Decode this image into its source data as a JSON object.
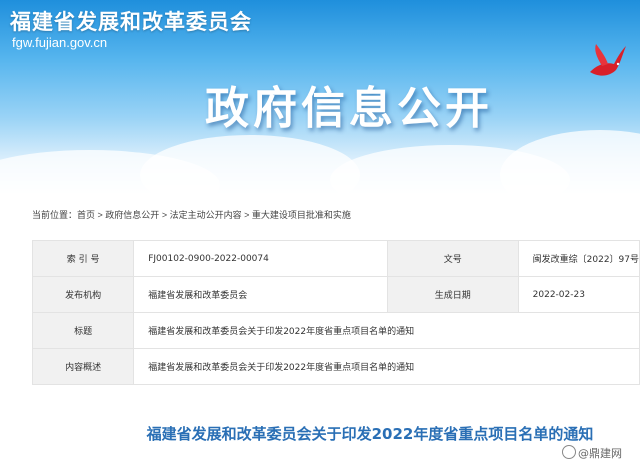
{
  "banner": {
    "org_name": "福建省发展和改革委员会",
    "url": "fgw.fujian.gov.cn",
    "heading": "政府信息公开"
  },
  "breadcrumb": {
    "prefix": "当前位置：",
    "items": [
      "首页",
      "政府信息公开",
      "法定主动公开内容",
      "重大建设项目批准和实施"
    ],
    "separator": " > "
  },
  "info_table": {
    "index_label": "索 引 号",
    "index_value": "FJ00102-0900-2022-00074",
    "docno_label": "文号",
    "docno_value": "闽发改重综〔2022〕97号",
    "publisher_label": "发布机构",
    "publisher_value": "福建省发展和改革委员会",
    "date_label": "生成日期",
    "date_value": "2022-02-23",
    "title_label": "标题",
    "title_value": "福建省发展和改革委员会关于印发2022年度省重点项目名单的通知",
    "summary_label": "内容概述",
    "summary_value": "福建省发展和改革委员会关于印发2022年度省重点项目名单的通知"
  },
  "document": {
    "title": "福建省发展和改革委员会关于印发2022年度省重点项目名单的通知"
  },
  "watermark": {
    "text": "@鼎建网"
  },
  "colors": {
    "banner_blue": "#1f8fdc",
    "title_blue": "#2a6fb5",
    "label_bg": "#f1f1f1",
    "bird_red": "#d8202a"
  }
}
